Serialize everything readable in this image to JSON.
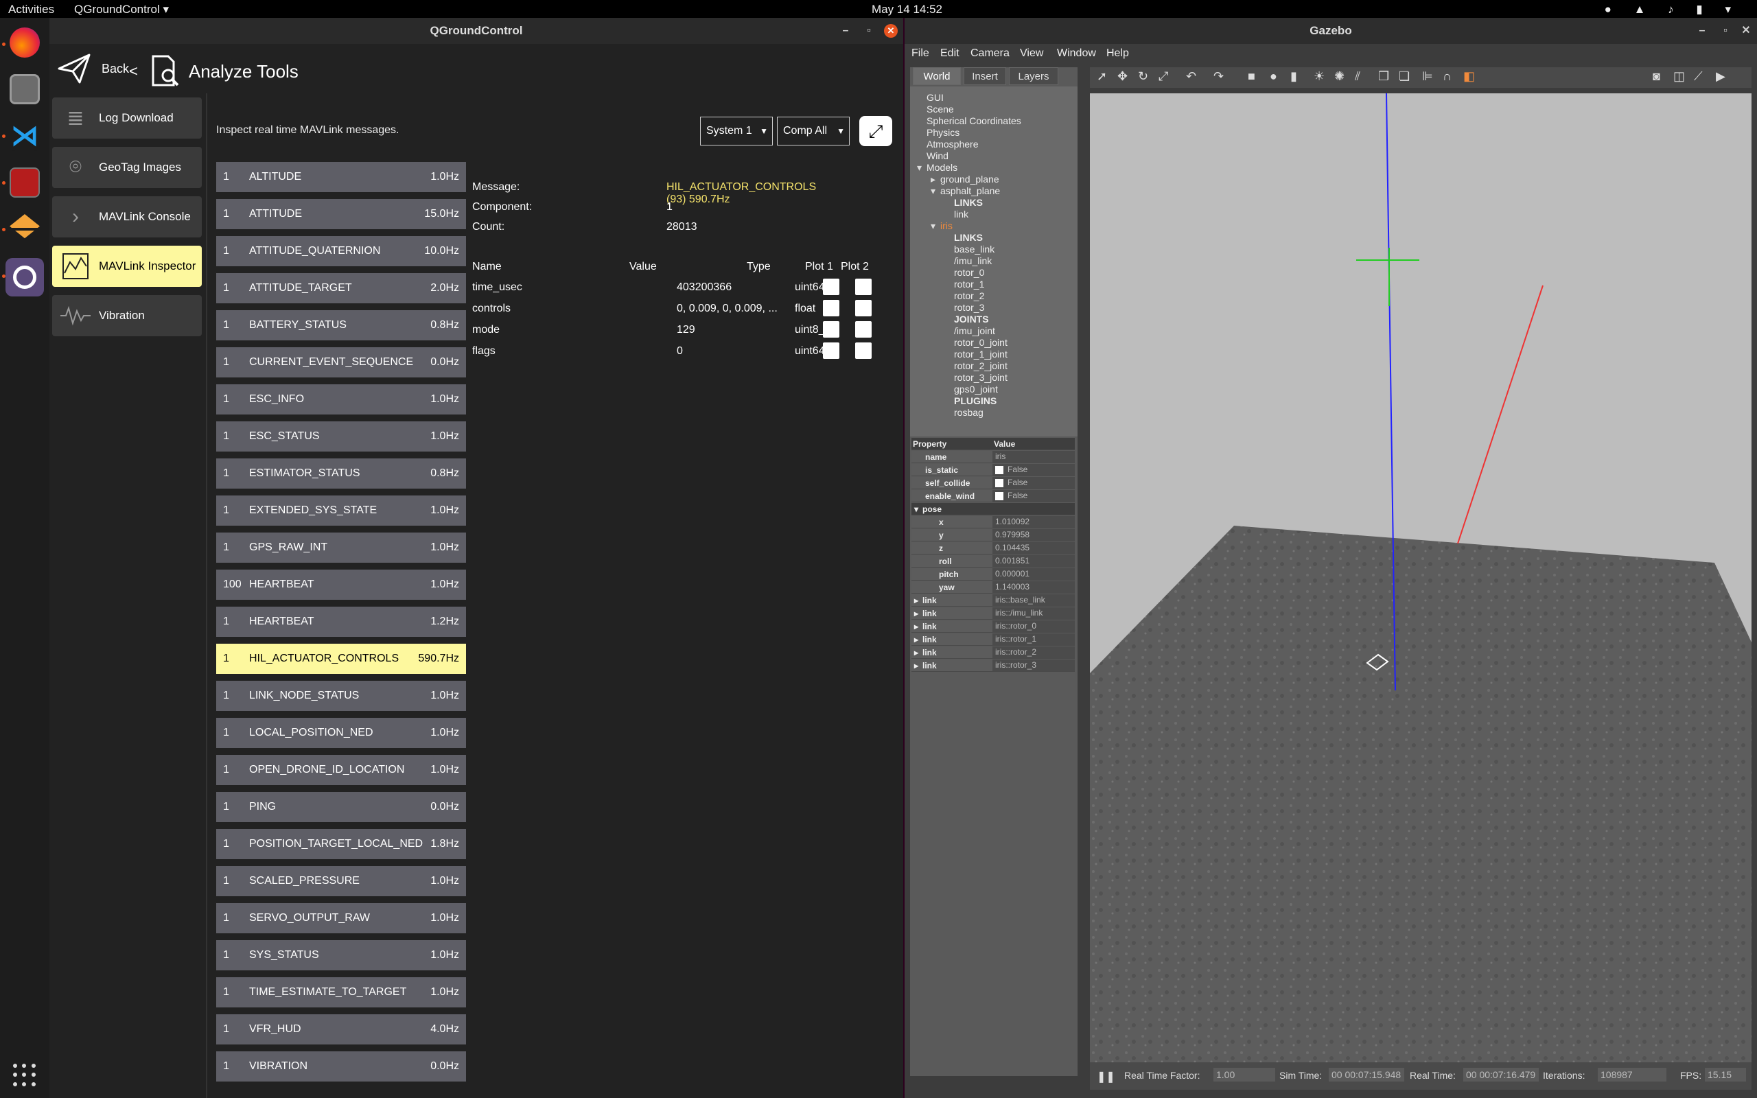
{
  "topbar": {
    "activities": "Activities",
    "app_menu": "QGroundControl ▾",
    "clock": "May 14  14:52",
    "tray": "● ▲ ♪ ▮ ▾"
  },
  "dock": {
    "icons": [
      "firefox-icon",
      "files-icon",
      "vscode-icon",
      "terminal-icon",
      "stack-icon",
      "qgc-icon"
    ]
  },
  "qgc": {
    "title": "QGroundControl",
    "back_label": "Back",
    "breadcrumb_sep": "<",
    "page_title": "Analyze Tools",
    "nav": [
      {
        "label": "Log Download",
        "icon": "list-icon"
      },
      {
        "label": "GeoTag Images",
        "icon": "map-pin-icon"
      },
      {
        "label": "MAVLink Console",
        "icon": "chevron-right-icon"
      },
      {
        "label": "MAVLink Inspector",
        "icon": "chart-icon"
      },
      {
        "label": "Vibration",
        "icon": "waveform-icon"
      }
    ],
    "intro": "Inspect real time MAVLink messages.",
    "system_select": "System 1",
    "component_select": "Comp All",
    "messages": [
      {
        "sys": "1",
        "name": "ALTITUDE",
        "hz": "1.0Hz"
      },
      {
        "sys": "1",
        "name": "ATTITUDE",
        "hz": "15.0Hz"
      },
      {
        "sys": "1",
        "name": "ATTITUDE_QUATERNION",
        "hz": "10.0Hz"
      },
      {
        "sys": "1",
        "name": "ATTITUDE_TARGET",
        "hz": "2.0Hz"
      },
      {
        "sys": "1",
        "name": "BATTERY_STATUS",
        "hz": "0.8Hz"
      },
      {
        "sys": "1",
        "name": "CURRENT_EVENT_SEQUENCE",
        "hz": "0.0Hz"
      },
      {
        "sys": "1",
        "name": "ESC_INFO",
        "hz": "1.0Hz"
      },
      {
        "sys": "1",
        "name": "ESC_STATUS",
        "hz": "1.0Hz"
      },
      {
        "sys": "1",
        "name": "ESTIMATOR_STATUS",
        "hz": "0.8Hz"
      },
      {
        "sys": "1",
        "name": "EXTENDED_SYS_STATE",
        "hz": "1.0Hz"
      },
      {
        "sys": "1",
        "name": "GPS_RAW_INT",
        "hz": "1.0Hz"
      },
      {
        "sys": "100",
        "name": "HEARTBEAT",
        "hz": "1.0Hz"
      },
      {
        "sys": "1",
        "name": "HEARTBEAT",
        "hz": "1.2Hz"
      },
      {
        "sys": "1",
        "name": "HIL_ACTUATOR_CONTROLS",
        "hz": "590.7Hz"
      },
      {
        "sys": "1",
        "name": "LINK_NODE_STATUS",
        "hz": "1.0Hz"
      },
      {
        "sys": "1",
        "name": "LOCAL_POSITION_NED",
        "hz": "1.0Hz"
      },
      {
        "sys": "1",
        "name": "OPEN_DRONE_ID_LOCATION",
        "hz": "1.0Hz"
      },
      {
        "sys": "1",
        "name": "PING",
        "hz": "0.0Hz"
      },
      {
        "sys": "1",
        "name": "POSITION_TARGET_LOCAL_NED",
        "hz": "1.8Hz"
      },
      {
        "sys": "1",
        "name": "SCALED_PRESSURE",
        "hz": "1.0Hz"
      },
      {
        "sys": "1",
        "name": "SERVO_OUTPUT_RAW",
        "hz": "1.0Hz"
      },
      {
        "sys": "1",
        "name": "SYS_STATUS",
        "hz": "1.0Hz"
      },
      {
        "sys": "1",
        "name": "TIME_ESTIMATE_TO_TARGET",
        "hz": "1.0Hz"
      },
      {
        "sys": "1",
        "name": "VFR_HUD",
        "hz": "4.0Hz"
      },
      {
        "sys": "1",
        "name": "VIBRATION",
        "hz": "0.0Hz"
      }
    ],
    "selected_index": 13,
    "detail": {
      "message_label": "Message:",
      "message_value": "HIL_ACTUATOR_CONTROLS (93) 590.7Hz",
      "component_label": "Component:",
      "component_value": "1",
      "count_label": "Count:",
      "count_value": "28013",
      "headers": {
        "name": "Name",
        "value": "Value",
        "type": "Type",
        "plot1": "Plot 1",
        "plot2": "Plot 2"
      },
      "fields": [
        {
          "name": "time_usec",
          "value": "403200366",
          "type": "uint64_t"
        },
        {
          "name": "controls",
          "value": "0, 0.009, 0, 0.009, ...",
          "type": "float"
        },
        {
          "name": "mode",
          "value": "129",
          "type": "uint8_t"
        },
        {
          "name": "flags",
          "value": "0",
          "type": "uint64_t"
        }
      ]
    }
  },
  "gazebo": {
    "title": "Gazebo",
    "menu": [
      "File",
      "Edit",
      "Camera",
      "View",
      "Window",
      "Help"
    ],
    "tabs": [
      "World",
      "Insert",
      "Layers"
    ],
    "tree": [
      {
        "label": "GUI",
        "indent": 0
      },
      {
        "label": "Scene",
        "indent": 0
      },
      {
        "label": "Spherical Coordinates",
        "indent": 0
      },
      {
        "label": "Physics",
        "indent": 0
      },
      {
        "label": "Atmosphere",
        "indent": 0
      },
      {
        "label": "Wind",
        "indent": 0
      },
      {
        "label": "Models",
        "indent": 0,
        "arrow": "▾"
      },
      {
        "label": "ground_plane",
        "indent": 1,
        "arrow": "▸"
      },
      {
        "label": "asphalt_plane",
        "indent": 1,
        "arrow": "▾"
      },
      {
        "label": "LINKS",
        "indent": 2,
        "bold": true
      },
      {
        "label": "link",
        "indent": 2
      },
      {
        "label": "iris",
        "indent": 1,
        "arrow": "▾",
        "orange": true
      },
      {
        "label": "LINKS",
        "indent": 2,
        "bold": true
      },
      {
        "label": "base_link",
        "indent": 2
      },
      {
        "label": "/imu_link",
        "indent": 2
      },
      {
        "label": "rotor_0",
        "indent": 2
      },
      {
        "label": "rotor_1",
        "indent": 2
      },
      {
        "label": "rotor_2",
        "indent": 2
      },
      {
        "label": "rotor_3",
        "indent": 2
      },
      {
        "label": "JOINTS",
        "indent": 2,
        "bold": true
      },
      {
        "label": "/imu_joint",
        "indent": 2
      },
      {
        "label": "rotor_0_joint",
        "indent": 2
      },
      {
        "label": "rotor_1_joint",
        "indent": 2
      },
      {
        "label": "rotor_2_joint",
        "indent": 2
      },
      {
        "label": "rotor_3_joint",
        "indent": 2
      },
      {
        "label": "gps0_joint",
        "indent": 2
      },
      {
        "label": "PLUGINS",
        "indent": 2,
        "bold": true
      },
      {
        "label": "rosbag",
        "indent": 2
      }
    ],
    "props_header": {
      "property": "Property",
      "value": "Value"
    },
    "props": [
      {
        "key": "name",
        "value": "iris",
        "indent": 1
      },
      {
        "key": "is_static",
        "value": "False",
        "check": true,
        "indent": 1
      },
      {
        "key": "self_collide",
        "value": "False",
        "check": true,
        "indent": 1
      },
      {
        "key": "enable_wind",
        "value": "False",
        "check": true,
        "indent": 1
      },
      {
        "key": "pose",
        "value": "",
        "arrow": "▾",
        "indent": 0,
        "group": true
      },
      {
        "key": "x",
        "value": "1.010092",
        "indent": 2
      },
      {
        "key": "y",
        "value": "0.979958",
        "indent": 2
      },
      {
        "key": "z",
        "value": "0.104435",
        "indent": 2
      },
      {
        "key": "roll",
        "value": "0.001851",
        "indent": 2
      },
      {
        "key": "pitch",
        "value": "0.000001",
        "indent": 2
      },
      {
        "key": "yaw",
        "value": "1.140003",
        "indent": 2
      },
      {
        "key": "link",
        "value": "iris::base_link",
        "arrow": "▸",
        "indent": 0
      },
      {
        "key": "link",
        "value": "iris::/imu_link",
        "arrow": "▸",
        "indent": 0
      },
      {
        "key": "link",
        "value": "iris::rotor_0",
        "arrow": "▸",
        "indent": 0
      },
      {
        "key": "link",
        "value": "iris::rotor_1",
        "arrow": "▸",
        "indent": 0
      },
      {
        "key": "link",
        "value": "iris::rotor_2",
        "arrow": "▸",
        "indent": 0
      },
      {
        "key": "link",
        "value": "iris::rotor_3",
        "arrow": "▸",
        "indent": 0
      }
    ],
    "status": {
      "rtf_label": "Real Time Factor:",
      "rtf_value": "1.00",
      "sim_label": "Sim Time:",
      "sim_value": "00 00:07:15.948",
      "real_label": "Real Time:",
      "real_value": "00 00:07:16.479",
      "iter_label": "Iterations:",
      "iter_value": "108987",
      "fps_label": "FPS:",
      "fps_value": "15.15"
    }
  }
}
